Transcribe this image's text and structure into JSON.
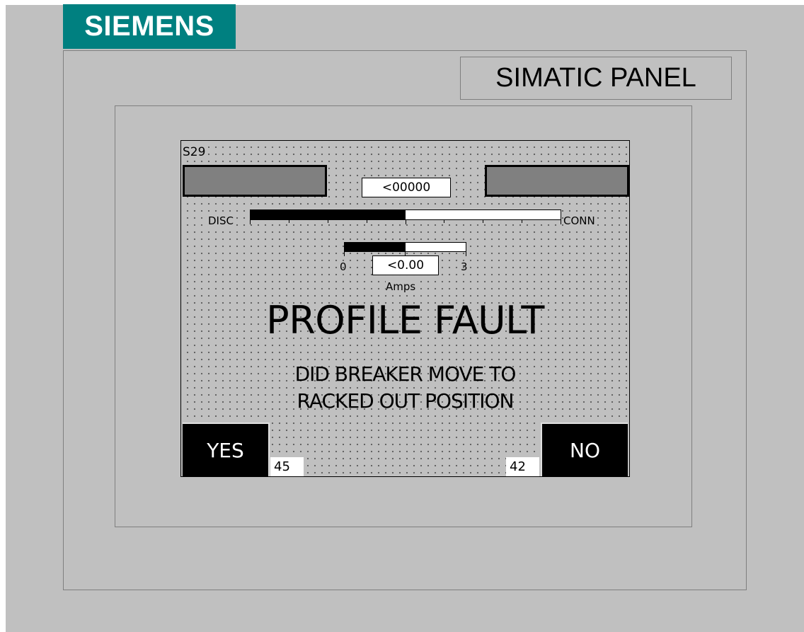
{
  "brand": {
    "logo_text": "SIEMENS",
    "color": "#008080"
  },
  "panel": {
    "label": "SIMATIC PANEL"
  },
  "screen": {
    "id": "S29",
    "counter": "<00000",
    "position": {
      "left_label": "DISC",
      "right_label": "CONN",
      "fill_fraction": 0.5
    },
    "current": {
      "min": "0",
      "max": "3",
      "value": "<0.00",
      "unit": "Amps",
      "fill_fraction": 0.5
    },
    "title": "PROFILE FAULT",
    "message_line1": "DID BREAKER MOVE TO",
    "message_line2": "RACKED OUT POSITION",
    "yes_button": {
      "label": "YES",
      "number": "45"
    },
    "no_button": {
      "label": "NO",
      "number": "42"
    }
  },
  "colors": {
    "background": "#c0c0c0",
    "indicator": "#808080",
    "button": "#000000"
  }
}
